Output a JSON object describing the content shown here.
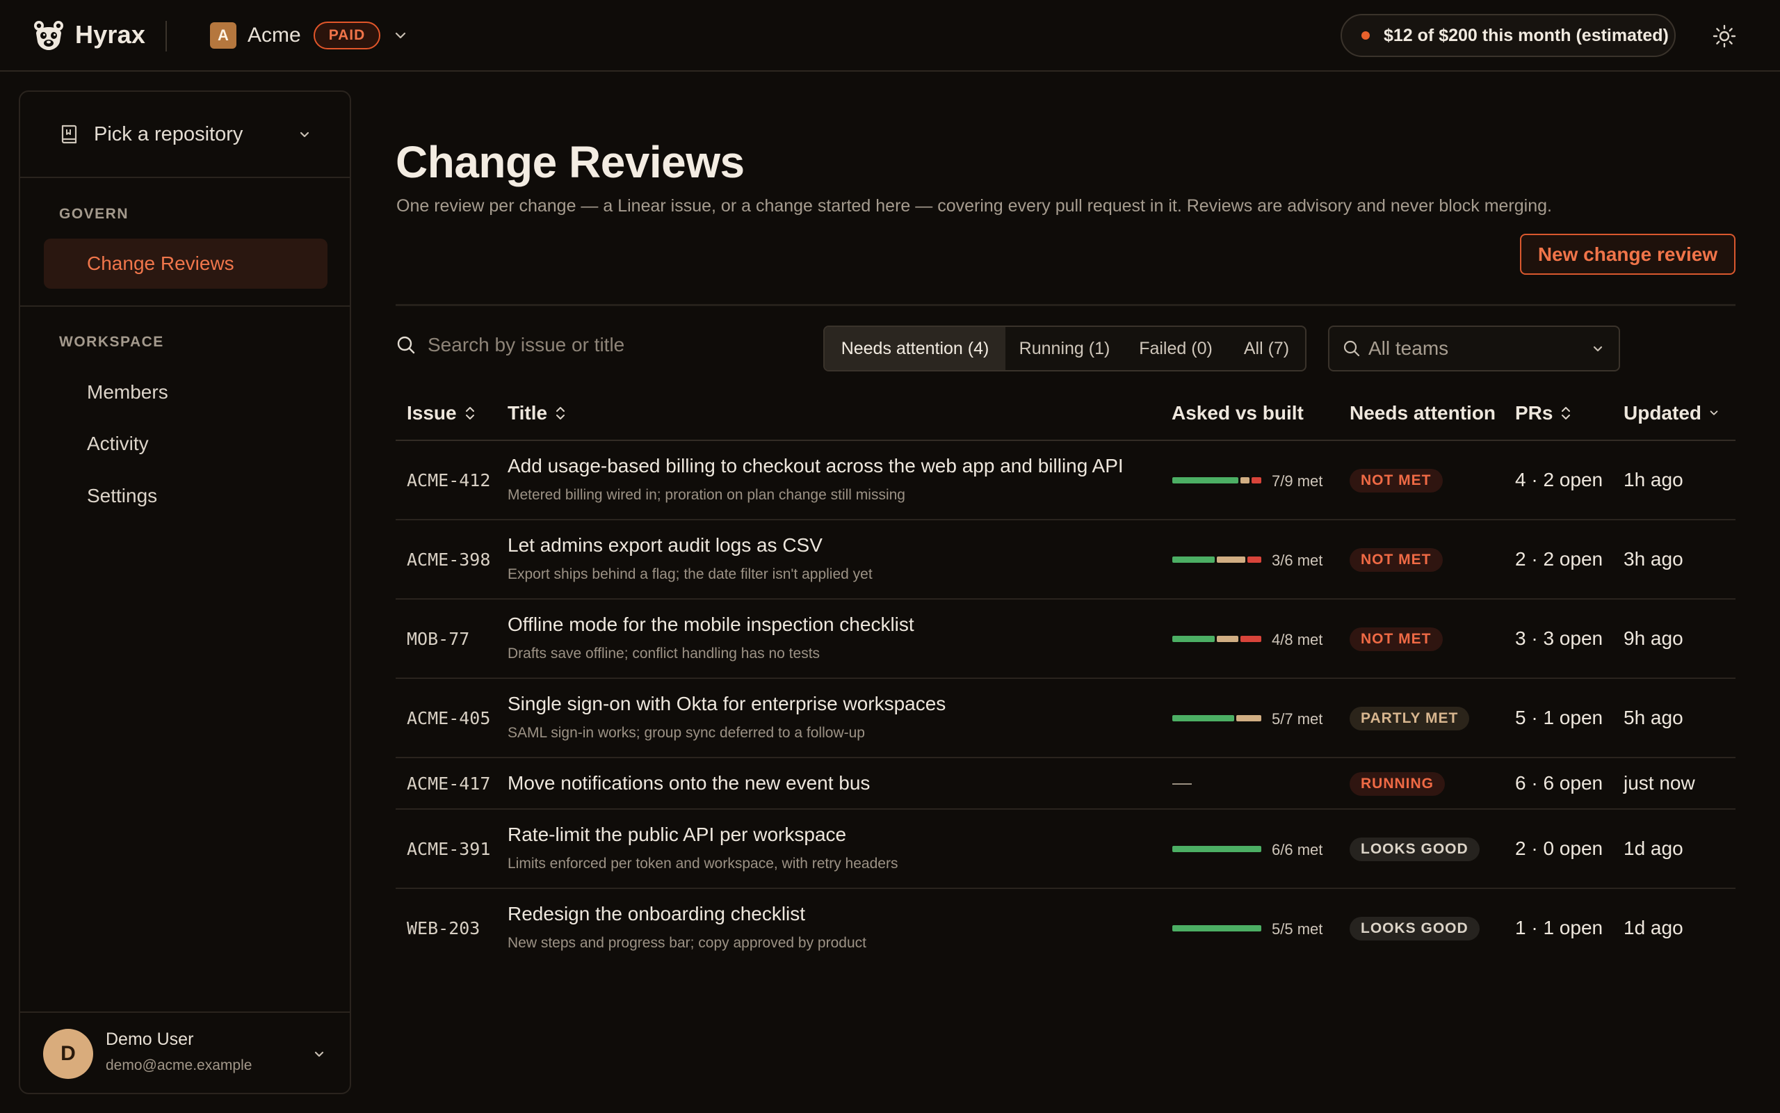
{
  "brand": {
    "name": "Hyrax"
  },
  "org": {
    "initial": "A",
    "name": "Acme",
    "plan_badge": "PAID"
  },
  "cost": {
    "text": "$12 of $200 this month (estimated)"
  },
  "sidebar": {
    "repo_picker": "Pick a repository",
    "govern_label": "GOVERN",
    "govern_items": [
      {
        "label": "Change Reviews",
        "active": true
      }
    ],
    "workspace_label": "WORKSPACE",
    "workspace_items": [
      {
        "label": "Members"
      },
      {
        "label": "Activity"
      },
      {
        "label": "Settings"
      }
    ],
    "user": {
      "initial": "D",
      "name": "Demo User",
      "email": "demo@acme.example"
    }
  },
  "main": {
    "title": "Change Reviews",
    "subtitle": "One review per change — a Linear issue, or a change started here — covering every pull request in it. Reviews are advisory and never block merging.",
    "new_button": "New change review",
    "search_placeholder": "Search by issue or title",
    "filters": [
      {
        "label": "Needs attention (4)",
        "active": true
      },
      {
        "label": "Running (1)",
        "active": false
      },
      {
        "label": "Failed (0)",
        "active": false
      },
      {
        "label": "All (7)",
        "active": false
      }
    ],
    "team_select": "All teams"
  },
  "table": {
    "columns": {
      "issue": "Issue",
      "title": "Title",
      "asked": "Asked vs built",
      "attention": "Needs attention",
      "prs": "PRs",
      "updated": "Updated"
    },
    "rows": [
      {
        "issue": "ACME-412",
        "title": "Add usage-based billing to checkout across the web app and billing API",
        "summary": "Metered billing wired in; proration on plan change still missing",
        "met": 7,
        "partly": 1,
        "not_met": 1,
        "met_text": "7/9 met",
        "status": "NOT MET",
        "status_kind": "not-met",
        "prs": "4 · 2 open",
        "updated": "1h ago"
      },
      {
        "issue": "ACME-398",
        "title": "Let admins export audit logs as CSV",
        "summary": "Export ships behind a flag; the date filter isn't applied yet",
        "met": 3,
        "partly": 2,
        "not_met": 1,
        "met_text": "3/6 met",
        "status": "NOT MET",
        "status_kind": "not-met",
        "prs": "2 · 2 open",
        "updated": "3h ago"
      },
      {
        "issue": "MOB-77",
        "title": "Offline mode for the mobile inspection checklist",
        "summary": "Drafts save offline; conflict handling has no tests",
        "met": 4,
        "partly": 2,
        "not_met": 2,
        "met_text": "4/8 met",
        "status": "NOT MET",
        "status_kind": "not-met",
        "prs": "3 · 3 open",
        "updated": "9h ago"
      },
      {
        "issue": "ACME-405",
        "title": "Single sign-on with Okta for enterprise workspaces",
        "summary": "SAML sign-in works; group sync deferred to a follow-up",
        "met": 5,
        "partly": 2,
        "not_met": 0,
        "met_text": "5/7 met",
        "status": "PARTLY MET",
        "status_kind": "partly-met",
        "prs": "5 · 1 open",
        "updated": "5h ago"
      },
      {
        "issue": "ACME-417",
        "title": "Move notifications onto the new event bus",
        "summary": "",
        "met_text": "—",
        "status": "RUNNING",
        "status_kind": "running",
        "prs": "6 · 6 open",
        "updated": "just now"
      },
      {
        "issue": "ACME-391",
        "title": "Rate-limit the public API per workspace",
        "summary": "Limits enforced per token and workspace, with retry headers",
        "met": 6,
        "partly": 0,
        "not_met": 0,
        "met_text": "6/6 met",
        "status": "LOOKS GOOD",
        "status_kind": "looks-good",
        "prs": "2 · 0 open",
        "updated": "1d ago"
      },
      {
        "issue": "WEB-203",
        "title": "Redesign the onboarding checklist",
        "summary": "New steps and progress bar; copy approved by product",
        "met": 5,
        "partly": 0,
        "not_met": 0,
        "met_text": "5/5 met",
        "status": "LOOKS GOOD",
        "status_kind": "looks-good",
        "prs": "1 · 1 open",
        "updated": "1d ago"
      }
    ]
  }
}
